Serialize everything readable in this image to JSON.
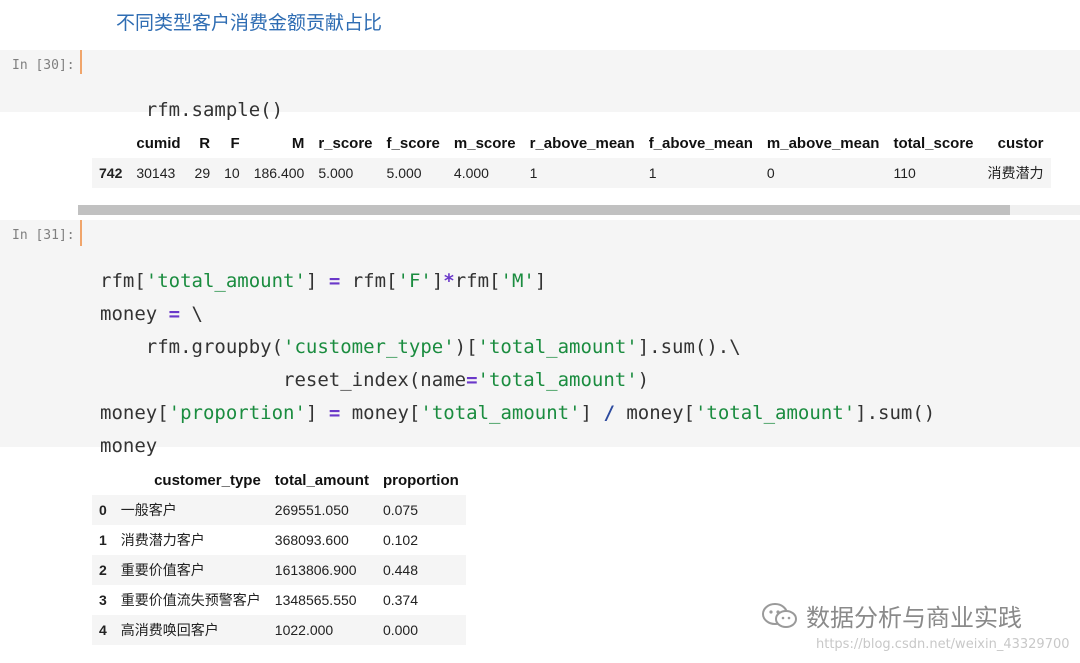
{
  "heading": "不同类型客户消费金额贡献占比",
  "cell30": {
    "prompt": "In [30]:",
    "code_line1": "rfm.sample()"
  },
  "table1": {
    "columns": [
      "",
      "cumid",
      "R",
      "F",
      "M",
      "r_score",
      "f_score",
      "m_score",
      "r_above_mean",
      "f_above_mean",
      "m_above_mean",
      "total_score",
      "custor"
    ],
    "row": [
      "742",
      "30143",
      "29",
      "10",
      "186.400",
      "5.000",
      "5.000",
      "4.000",
      "1",
      "1",
      "0",
      "110",
      "消费潜力"
    ]
  },
  "cell31": {
    "prompt": "In [31]:",
    "tokens": {
      "rfm": "rfm",
      "lb": "[",
      "rb": "]",
      "eq": "=",
      "s_total_amount": "'total_amount'",
      "s_F": "'F'",
      "s_M": "'M'",
      "s_customer_type": "'customer_type'",
      "s_proportion": "'proportion'",
      "star": "*",
      "slash": "/",
      "bs": "\\",
      "money": "money",
      "groupby": "rfm.groupby(",
      "sum_dot": "].sum().",
      "reset": "reset_index(name",
      "close_paren": ")",
      "sum_call": "].sum()",
      "money_eq": "money ",
      "money_lb": "money[",
      "rfm_lb": "rfm["
    }
  },
  "table2": {
    "columns": [
      "",
      "customer_type",
      "total_amount",
      "proportion"
    ],
    "rows": [
      [
        "0",
        "一般客户",
        "269551.050",
        "0.075"
      ],
      [
        "1",
        "消费潜力客户",
        "368093.600",
        "0.102"
      ],
      [
        "2",
        "重要价值客户",
        "1613806.900",
        "0.448"
      ],
      [
        "3",
        "重要价值流失预警客户",
        "1348565.550",
        "0.374"
      ],
      [
        "4",
        "高消费唤回客户",
        "1022.000",
        "0.000"
      ]
    ]
  },
  "watermark": {
    "text": "数据分析与商业实践",
    "url": "https://blog.csdn.net/weixin_43329700"
  }
}
